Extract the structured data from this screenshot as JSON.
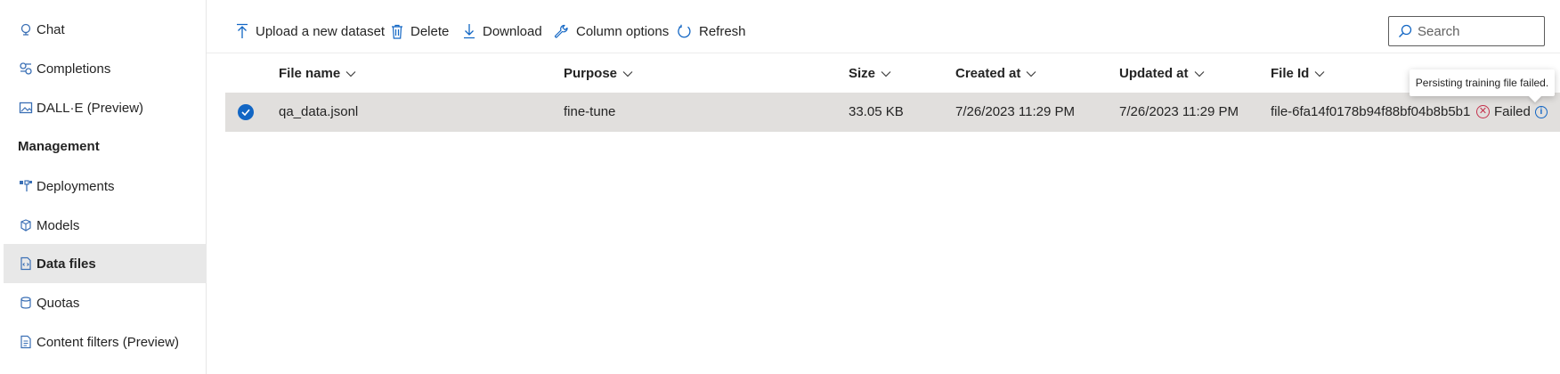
{
  "sidebar": {
    "items": [
      {
        "label": "Chat",
        "icon": "chat-icon"
      },
      {
        "label": "Completions",
        "icon": "completions-icon"
      },
      {
        "label": "DALL·E (Preview)",
        "icon": "image-icon"
      }
    ],
    "section_label": "Management",
    "management_items": [
      {
        "label": "Deployments",
        "icon": "deployments-icon"
      },
      {
        "label": "Models",
        "icon": "models-icon"
      },
      {
        "label": "Data files",
        "icon": "data-files-icon",
        "selected": true
      },
      {
        "label": "Quotas",
        "icon": "quotas-icon"
      },
      {
        "label": "Content filters (Preview)",
        "icon": "content-filters-icon"
      }
    ]
  },
  "toolbar": {
    "upload_label": "Upload a new dataset",
    "delete_label": "Delete",
    "download_label": "Download",
    "column_options_label": "Column options",
    "refresh_label": "Refresh",
    "search_placeholder": "Search"
  },
  "table": {
    "columns": [
      "File name",
      "Purpose",
      "Size",
      "Created at",
      "Updated at",
      "File Id"
    ],
    "rows": [
      {
        "selected": true,
        "file_name": "qa_data.jsonl",
        "purpose": "fine-tune",
        "size": "33.05 KB",
        "created_at": "7/26/2023 11:29 PM",
        "updated_at": "7/26/2023 11:29 PM",
        "file_id": "file-6fa14f0178b94f88bf04b8b5b1",
        "status": "Failed"
      }
    ]
  },
  "tooltip": {
    "text": "Persisting training file failed."
  },
  "colors": {
    "accent": "#1266c4",
    "error": "#c4314b",
    "selected_row": "#e1dfdd",
    "selected_nav": "#e8e8e8"
  }
}
